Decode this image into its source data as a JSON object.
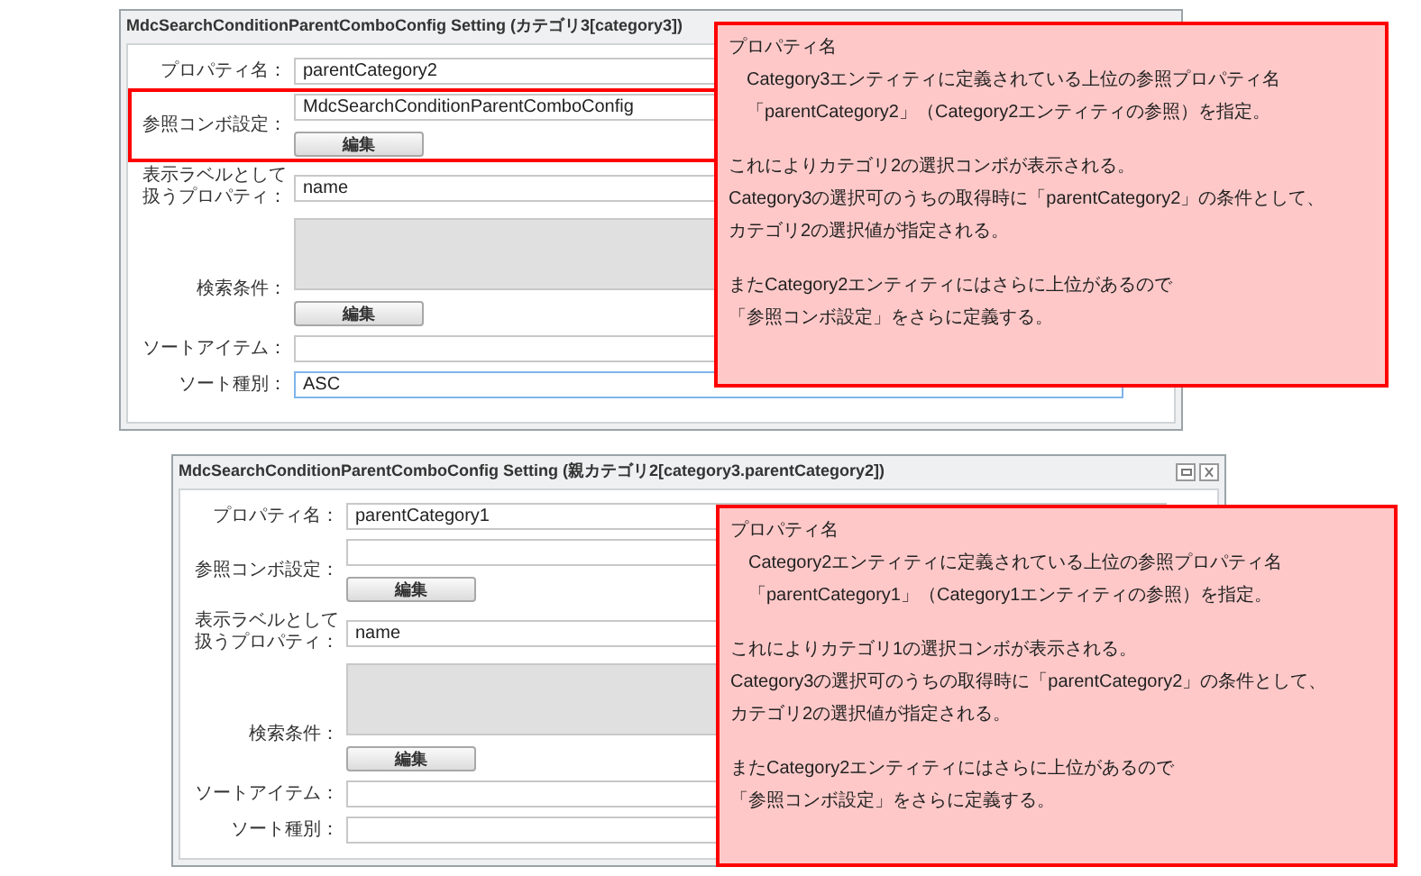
{
  "dialogs": [
    {
      "title": "MdcSearchConditionParentComboConfig Setting (カテゴリ3[category3])",
      "title_buttons": false,
      "rows": [
        {
          "kind": "text",
          "label": "プロパティ名：",
          "value": "parentCategory2",
          "highlighted": false
        },
        {
          "kind": "text_button",
          "label": "参照コンボ設定：",
          "value": "MdcSearchConditionParentComboConfig",
          "button": "編集",
          "highlighted": true
        },
        {
          "kind": "text",
          "label": [
            "表示ラベルとして",
            "扱うプロパティ："
          ],
          "value": "name",
          "highlighted": false
        },
        {
          "kind": "area_button",
          "label": "検索条件：",
          "button": "編集",
          "highlighted": false
        },
        {
          "kind": "text",
          "label": "ソートアイテム：",
          "highlighted": false
        },
        {
          "kind": "select",
          "label": "ソート種別：",
          "value": "ASC",
          "focused": true,
          "highlighted": false
        }
      ]
    },
    {
      "title": "MdcSearchConditionParentComboConfig Setting (親カテゴリ2[category3.parentCategory2])",
      "title_buttons": true,
      "rows": [
        {
          "kind": "text",
          "label": "プロパティ名：",
          "value": "parentCategory1",
          "highlighted": false
        },
        {
          "kind": "text_button",
          "label": "参照コンボ設定：",
          "button": "編集",
          "highlighted": false
        },
        {
          "kind": "text",
          "label": [
            "表示ラベルとして",
            "扱うプロパティ："
          ],
          "value": "name",
          "highlighted": false
        },
        {
          "kind": "area_button",
          "label": "検索条件：",
          "button": "編集",
          "highlighted": false
        },
        {
          "kind": "text",
          "label": "ソートアイテム：",
          "highlighted": false
        },
        {
          "kind": "select",
          "label": "ソート種別：",
          "focused": false,
          "highlighted": false
        }
      ]
    }
  ],
  "callouts": [
    {
      "paragraphs": [
        [
          {
            "text": "プロパティ名",
            "indented": false
          },
          {
            "text": "Category3エンティティに定義されている上位の参照プロパティ名",
            "indented": true
          },
          {
            "text": "「parentCategory2」（Category2エンティティの参照）を指定。",
            "indented": true
          }
        ],
        [
          {
            "text": "これによりカテゴリ2の選択コンボが表示される。",
            "indented": false
          },
          {
            "text": "Category3の選択可のうちの取得時に「parentCategory2」の条件として、",
            "indented": false
          },
          {
            "text": "カテゴリ2の選択値が指定される。",
            "indented": false
          }
        ],
        [
          {
            "text": "またCategory2エンティティにはさらに上位があるので",
            "indented": false
          },
          {
            "text": "「参照コンボ設定」をさらに定義する。",
            "indented": false
          }
        ]
      ]
    },
    {
      "paragraphs": [
        [
          {
            "text": "プロパティ名",
            "indented": false
          },
          {
            "text": "Category2エンティティに定義されている上位の参照プロパティ名",
            "indented": true
          },
          {
            "text": "「parentCategory1」（Category1エンティティの参照）を指定。",
            "indented": true
          }
        ],
        [
          {
            "text": "これによりカテゴリ1の選択コンボが表示される。",
            "indented": false
          },
          {
            "text": "Category3の選択可のうちの取得時に「parentCategory2」の条件として、",
            "indented": false
          },
          {
            "text": "カテゴリ2の選択値が指定される。",
            "indented": false
          }
        ],
        [
          {
            "text": "またCategory2エンティティにはさらに上位があるので",
            "indented": false
          },
          {
            "text": "「参照コンボ設定」をさらに定義する。",
            "indented": false
          }
        ]
      ]
    }
  ]
}
